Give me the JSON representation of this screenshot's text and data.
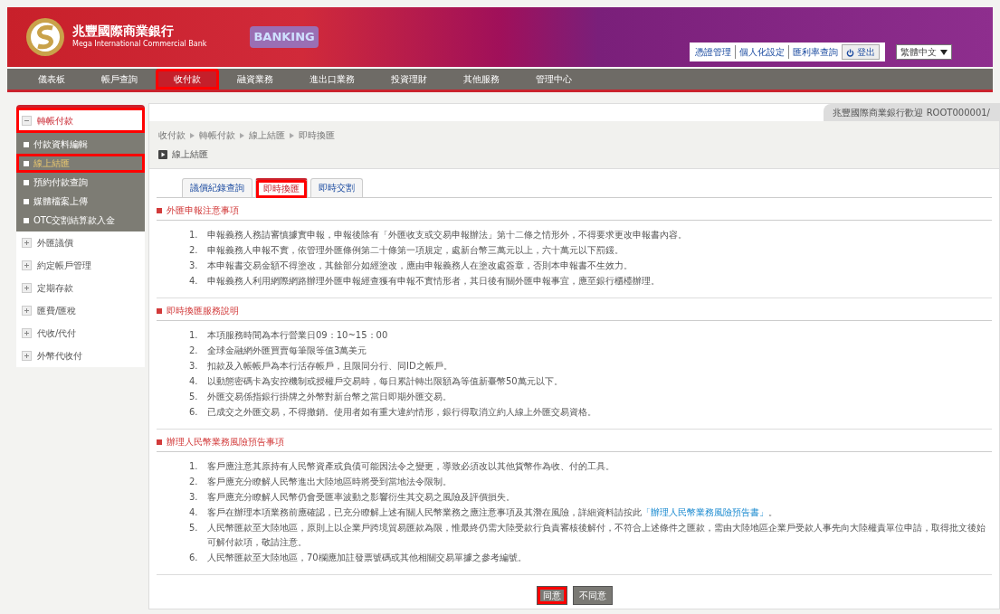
{
  "header": {
    "bank_name": "兆豐國際商業銀行",
    "bank_name_en": "Mega International Commercial Bank",
    "logo_text": "BANKING",
    "links": [
      {
        "label": "憑證管理"
      },
      {
        "label": "個人化設定"
      },
      {
        "label": "匯利率查詢"
      }
    ],
    "logout": "登出",
    "language": "繁體中文"
  },
  "nav": [
    {
      "label": "儀表板",
      "selected": false,
      "highlighted": false
    },
    {
      "label": "帳戶查詢",
      "selected": false,
      "highlighted": false
    },
    {
      "label": "收付款",
      "selected": true,
      "highlighted": true
    },
    {
      "label": "融資業務",
      "selected": false,
      "highlighted": false
    },
    {
      "label": "進出口業務",
      "selected": false,
      "highlighted": false
    },
    {
      "label": "投資理財",
      "selected": false,
      "highlighted": false
    },
    {
      "label": "其他服務",
      "selected": false,
      "highlighted": false
    },
    {
      "label": "管理中心",
      "selected": false,
      "highlighted": false
    }
  ],
  "sidebar": [
    {
      "label": "轉帳付款",
      "expanded": true,
      "highlighted": true,
      "children": [
        {
          "label": "付款資料編輯",
          "selected": false,
          "highlighted": false
        },
        {
          "label": "線上結匯",
          "selected": true,
          "highlighted": true
        },
        {
          "label": "預約付款查詢",
          "selected": false,
          "highlighted": false
        },
        {
          "label": "媒體檔案上傳",
          "selected": false,
          "highlighted": false
        },
        {
          "label": "OTC交割結算款入金",
          "selected": false,
          "highlighted": false
        }
      ]
    },
    {
      "label": "外匯議價",
      "expanded": false,
      "highlighted": false
    },
    {
      "label": "約定帳戶管理",
      "expanded": false,
      "highlighted": false
    },
    {
      "label": "定期存款",
      "expanded": false,
      "highlighted": false
    },
    {
      "label": "匯費/匯稅",
      "expanded": false,
      "highlighted": false
    },
    {
      "label": "代收/代付",
      "expanded": false,
      "highlighted": false
    },
    {
      "label": "外幣代收付",
      "expanded": false,
      "highlighted": false
    }
  ],
  "welcome": "兆豐國際商業銀行歡迎 ROOT000001/",
  "breadcrumb": [
    "收付款",
    "轉帳付款",
    "線上結匯",
    "即時換匯"
  ],
  "page_title": "線上結匯",
  "tabs": [
    {
      "label": "議價紀錄查詢",
      "selected": false,
      "highlighted": false
    },
    {
      "label": "即時換匯",
      "selected": true,
      "highlighted": true
    },
    {
      "label": "即時交割",
      "selected": false,
      "highlighted": false
    }
  ],
  "sections": [
    {
      "title": "外匯申報注意事項",
      "items": [
        {
          "num": "1.",
          "text": "申報義務人務請審慎據實申報，申報後除有「外匯收支或交易申報辦法」第十二條之情形外，不得要求更改申報書內容。"
        },
        {
          "num": "2.",
          "text": "申報義務人申報不實，依管理外匯條例第二十條第一項規定，處新台幣三萬元以上，六十萬元以下罰鍰。"
        },
        {
          "num": "3.",
          "text": "本申報書交易金額不得塗改，其餘部分如經塗改，應由申報義務人在塗改處簽章，否則本申報書不生效力。"
        },
        {
          "num": "4.",
          "text": "申報義務人利用網際網路辦理外匯申報經查獲有申報不實情形者，其日後有關外匯申報事宜，應至銀行櫃檯辦理。"
        }
      ]
    },
    {
      "title": "即時換匯服務說明",
      "items": [
        {
          "num": "1.",
          "text": "本項服務時間為本行營業日09：10~15：00"
        },
        {
          "num": "2.",
          "text": "全球金融網外匯買賣每筆限等值3萬美元"
        },
        {
          "num": "3.",
          "text": "扣款及入帳帳戶為本行活存帳戶，且限同分行、同ID之帳戶。"
        },
        {
          "num": "4.",
          "text": "以動態密碼卡為安控機制或授權戶交易時，每日累計轉出限額為等值新臺幣50萬元以下。"
        },
        {
          "num": "5.",
          "text": "外匯交易係指銀行掛牌之外幣對新台幣之當日即期外匯交易。"
        },
        {
          "num": "6.",
          "text": "已成交之外匯交易，不得撤銷。使用者如有重大違約情形，銀行得取消立約人線上外匯交易資格。"
        }
      ]
    },
    {
      "title": "辦理人民幣業務風險預告事項",
      "items": [
        {
          "num": "1.",
          "text": "客戶應注意其原持有人民幣資產或負債可能因法令之變更，導致必須改以其他貨幣作為收、付的工具。"
        },
        {
          "num": "2.",
          "text": "客戶應充分瞭解人民幣進出大陸地區時將受到當地法令限制。"
        },
        {
          "num": "3.",
          "text": "客戶應充分瞭解人民幣仍會受匯率波動之影響衍生其交易之風險及評價損失。"
        },
        {
          "num": "4.",
          "text": "客戶在辦理本項業務前應確認，已充分瞭解上述有關人民幣業務之應注意事項及其潛在風險，詳細資料請按此",
          "link": "「辦理人民幣業務風險預告書」",
          "after": "。"
        },
        {
          "num": "5.",
          "text": "人民幣匯款至大陸地區，原則上以企業戶跨境貿易匯款為限，惟最終仍需大陸受款行負責審核後解付，不符合上述條件之匯款，需由大陸地區企業戶受款人事先向大陸權責單位申請，取得批文後始可解付款項，敬請注意。"
        },
        {
          "num": "6.",
          "text": "人民幣匯款至大陸地區，70欄應加註發票號碼或其他相關交易單據之參考編號。"
        }
      ]
    }
  ],
  "buttons": [
    {
      "label": "同意",
      "highlighted": true
    },
    {
      "label": "不同意",
      "highlighted": false
    }
  ]
}
